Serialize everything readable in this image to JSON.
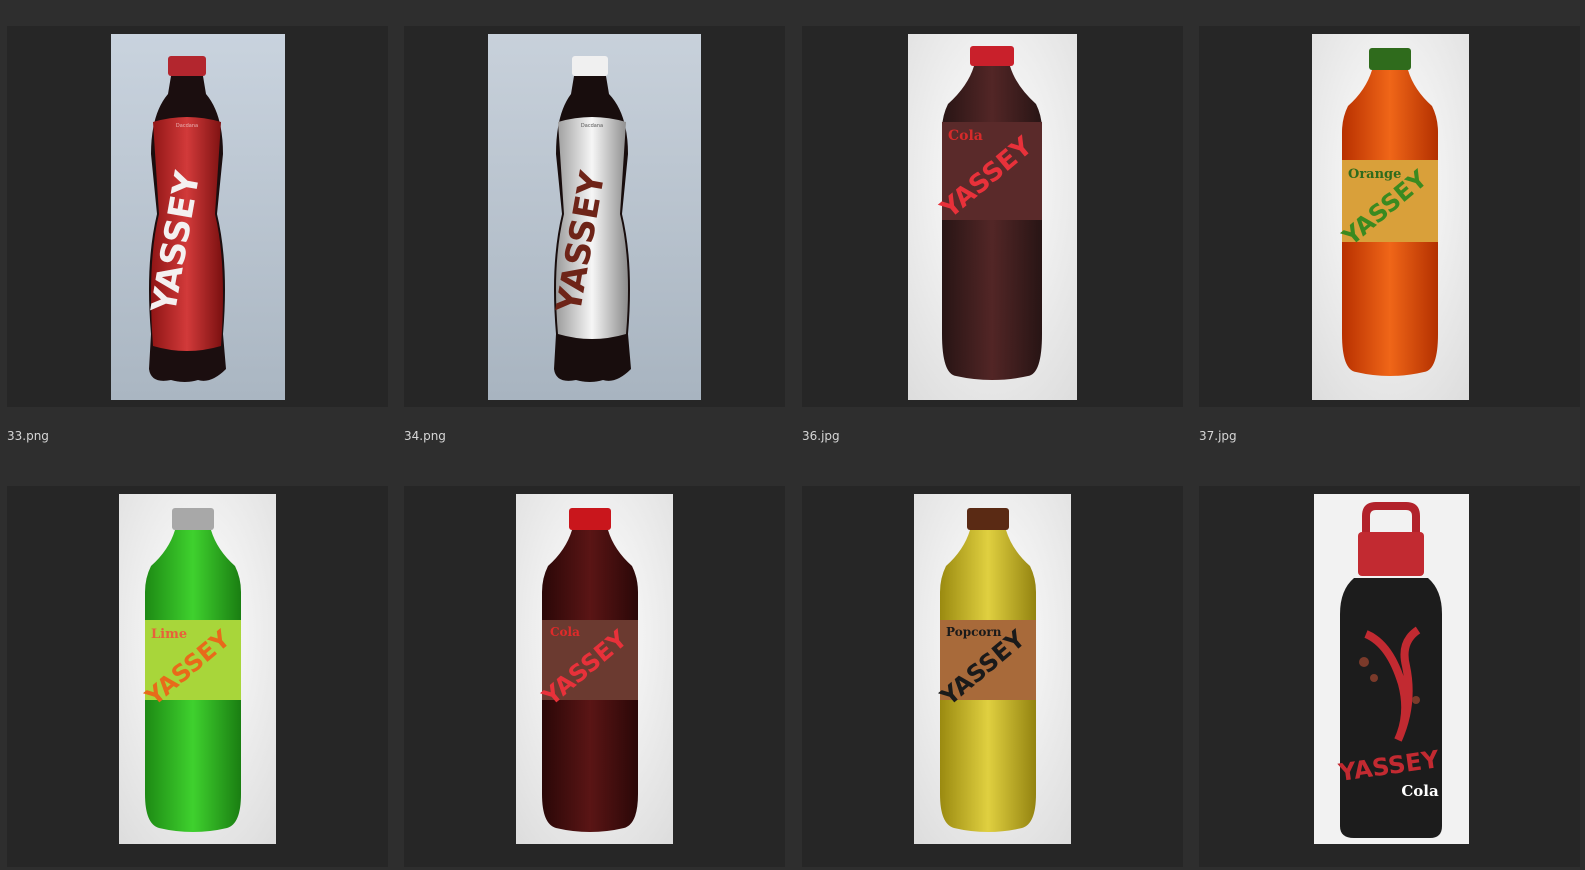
{
  "gallery": {
    "items": [
      {
        "filename": "33.png",
        "brand": "YASSEY",
        "flavor": "",
        "label_small": "Dacdana"
      },
      {
        "filename": "34.png",
        "brand": "YASSEY",
        "flavor": "",
        "label_small": "Dacdana"
      },
      {
        "filename": "36.jpg",
        "brand": "YASSEY",
        "flavor": "Cola"
      },
      {
        "filename": "37.jpg",
        "brand": "YASSEY",
        "flavor": "Orange"
      },
      {
        "filename": "",
        "brand": "YASSEY",
        "flavor": "Lime"
      },
      {
        "filename": "",
        "brand": "YASSEY",
        "flavor": "Cola"
      },
      {
        "filename": "",
        "brand": "YASSEY",
        "flavor": "Popcorn"
      },
      {
        "filename": "",
        "brand": "YASSEY",
        "flavor": "Cola"
      }
    ]
  },
  "colors": {
    "background": "#2e2e2e",
    "thumb_frame": "#262626",
    "text": "#d6d6d6"
  }
}
